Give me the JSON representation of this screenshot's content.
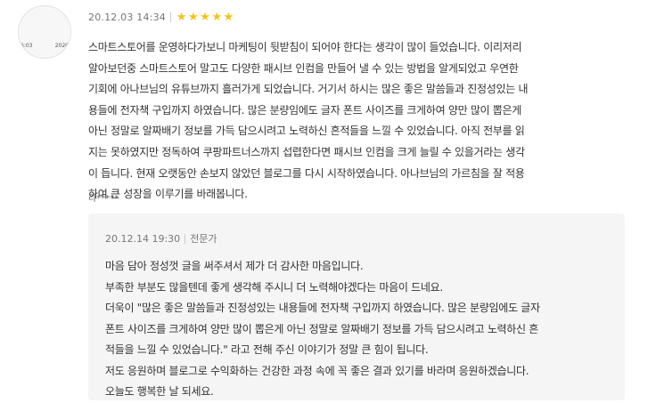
{
  "review": {
    "avatar_left": "6:03",
    "avatar_right": "2020",
    "date": "20.12.03 14:34",
    "rating": 5,
    "lines": [
      "스마트스토어를 운영하다가보니 마케팅이 뒷받침이 되어야 한다는 생각이 많이 들었습니다. 이리저리",
      "알아보던중 스마트스토어 말고도 다양한 패시브 인컴을 만들어 낼 수 있는 방법을 알게되었고 우연한",
      "기회에 아나브님의 유튜브까지 흘러가게 되었습니다. 거기서 하시는 많은 좋은 말씀들과 진정성있는 내",
      "용들에 전자책 구입까지 하였습니다. 많은 분량임에도 글자 폰트 사이즈를 크게하여 양만 많이 뽑은게",
      "아닌 정말로 알짜배기 정보를 가득 담으시려고 노력하신 흔적들을 느낄 수 있었습니다. 아직 전부를 읽",
      "지는 못하였지만 정독하여 쿠팡파트너스까지 섭렵한다면 패시브 인컴을 크게 늘릴 수 있을거라는 생각",
      "이 듭니다. 현재 오랫동안 손보지 않았던 블로그를 다시 시작하였습니다. 아나브님의 가르침을 잘 적용",
      "하여 큰 성장을 이루기를 바래봅니다."
    ],
    "author": "라*****"
  },
  "reply": {
    "date": "20.12.14 19:30",
    "role": "전문가",
    "lines": [
      "마음 담아 정성껏 글을 써주셔서 제가 더 감사한 마음입니다.",
      "부족한 부분도 많을텐데 좋게 생각해 주시니 더 노력해야겠다는 마음이 드네요.",
      "더욱이 \"많은 좋은 말씀들과 진정성있는 내용들에 전자책 구입까지 하였습니다. 많은 분량임에도 글자",
      "폰트 사이즈를 크게하여 양만 많이 뽑은게 아닌 정말로 알짜배기 정보를 가득 담으시려고 노력하신 흔",
      "적들을 느낄 수 있었습니다.\" 라고 전해 주신 이야기가 정말 큰 힘이 됩니다.",
      "저도 응원하며 블로그로 수익화하는 건강한 과정 속에 꼭 좋은 결과 있기를 바라며 응원하겠습니다.",
      "오늘도 행복한 날 되세요."
    ]
  },
  "colors": {
    "star": "#f6c21a",
    "reply_bg": "#f5f5f5"
  }
}
